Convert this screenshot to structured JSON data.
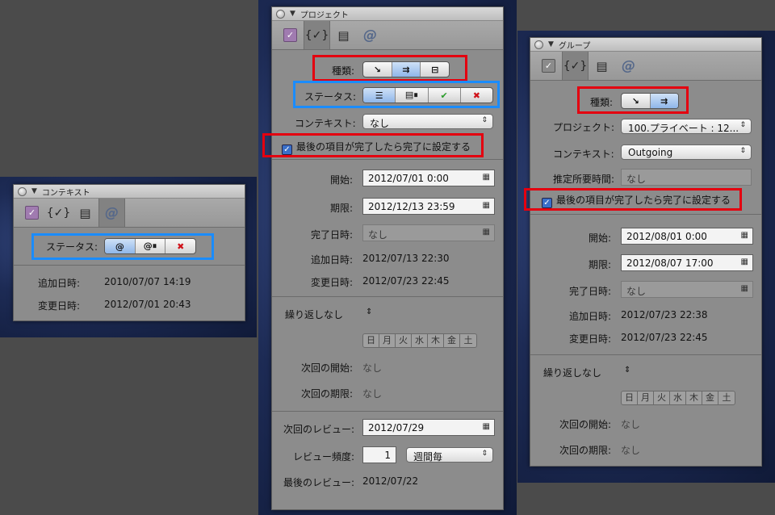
{
  "windows": {
    "context": {
      "title": "コンテキスト",
      "status_label": "ステータス:",
      "added_label": "追加日時:",
      "added_value": "2010/07/07 14:19",
      "modified_label": "変更日時:",
      "modified_value": "2012/07/01 20:43"
    },
    "project": {
      "title": "プロジェクト",
      "type_label": "種類:",
      "status_label": "ステータス:",
      "context_label": "コンテキスト:",
      "context_value": "なし",
      "complete_checkbox_label": "最後の項目が完了したら完了に設定する",
      "start_label": "開始:",
      "start_value": "2012/07/01 0:00",
      "due_label": "期限:",
      "due_value": "2012/12/13 23:59",
      "completed_label": "完了日時:",
      "completed_value": "なし",
      "added_label": "追加日時:",
      "added_value": "2012/07/13 22:30",
      "modified_label": "変更日時:",
      "modified_value": "2012/07/23 22:45",
      "repeat_value": "繰り返しなし",
      "weekdays": [
        "日",
        "月",
        "火",
        "水",
        "木",
        "金",
        "土"
      ],
      "next_start_label": "次回の開始:",
      "next_start_value": "なし",
      "next_due_label": "次回の期限:",
      "next_due_value": "なし",
      "next_review_label": "次回のレビュー:",
      "next_review_value": "2012/07/29",
      "review_freq_label": "レビュー頻度:",
      "review_freq_number": "1",
      "review_freq_unit": "週間毎",
      "last_review_label": "最後のレビュー:",
      "last_review_value": "2012/07/22"
    },
    "group": {
      "title": "グループ",
      "type_label": "種類:",
      "project_label": "プロジェクト:",
      "project_value": "100.プライベート : 12...",
      "context_label": "コンテキスト:",
      "context_value": "Outgoing",
      "estimate_label": "推定所要時間:",
      "estimate_value": "なし",
      "complete_checkbox_label": "最後の項目が完了したら完了に設定する",
      "start_label": "開始:",
      "start_value": "2012/08/01 0:00",
      "due_label": "期限:",
      "due_value": "2012/08/07 17:00",
      "completed_label": "完了日時:",
      "completed_value": "なし",
      "added_label": "追加日時:",
      "added_value": "2012/07/23 22:38",
      "modified_label": "変更日時:",
      "modified_value": "2012/07/23 22:45",
      "repeat_value": "繰り返しなし",
      "weekdays": [
        "日",
        "月",
        "火",
        "水",
        "木",
        "金",
        "土"
      ],
      "next_start_label": "次回の開始:",
      "next_start_value": "なし",
      "next_due_label": "次回の期限:",
      "next_due_value": "なし"
    }
  },
  "icons": {
    "check": "✓",
    "triangle": "▼",
    "stack": "{✓}",
    "at": "@",
    "updown": "⇕",
    "chev": "⌃⌄"
  },
  "colors": {
    "highlight_red": "#e4000f",
    "highlight_blue": "#1a8cff",
    "accent_purple": "#a07bb0"
  }
}
